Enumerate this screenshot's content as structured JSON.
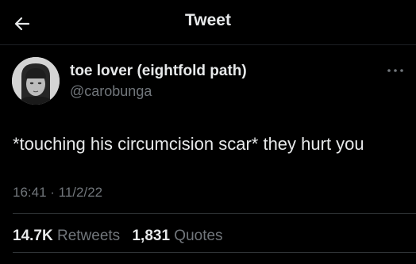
{
  "header": {
    "back_icon": "arrow-left-icon",
    "title": "Tweet"
  },
  "tweet": {
    "author": {
      "display_name": "toe lover (eightfold path)",
      "handle": "@carobunga",
      "avatar_icon": "profile-photo"
    },
    "more_icon": "more-horizontal-icon",
    "text": "*touching his circumcision scar* they hurt you",
    "timestamp": "16:41 · 11/2/22",
    "stats": {
      "retweets_count": "14.7K",
      "retweets_label": "Retweets",
      "quotes_count": "1,831",
      "quotes_label": "Quotes"
    }
  },
  "colors": {
    "background": "#000000",
    "primary_text": "#e7e9ea",
    "secondary_text": "#71767b",
    "divider": "#2f3336"
  }
}
